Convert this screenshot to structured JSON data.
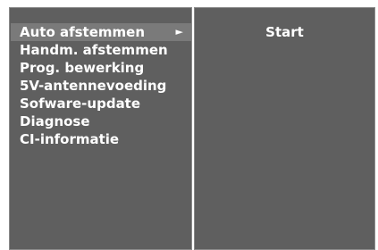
{
  "menu": {
    "items": [
      {
        "label": "Auto afstemmen",
        "arrow": "►"
      },
      {
        "label": "Handm. afstemmen"
      },
      {
        "label": "Prog. bewerking"
      },
      {
        "label": "5V-antennevoeding"
      },
      {
        "label": "Sofware-update"
      },
      {
        "label": "Diagnose"
      },
      {
        "label": "CI-informatie"
      }
    ],
    "selected_index": 0
  },
  "submenu": {
    "items": [
      {
        "label": "Start"
      }
    ]
  }
}
